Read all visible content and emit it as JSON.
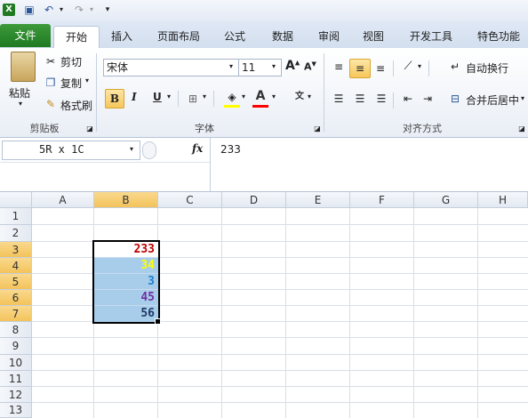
{
  "tabs": [
    "文件",
    "开始",
    "插入",
    "页面布局",
    "公式",
    "数据",
    "审阅",
    "视图",
    "开发工具",
    "特色功能"
  ],
  "clipboard": {
    "paste": "粘贴",
    "cut": "剪切",
    "copy": "复制",
    "format_painter": "格式刷",
    "group": "剪贴板"
  },
  "font": {
    "name": "宋体",
    "size": "11",
    "bold": "B",
    "italic": "I",
    "underline": "U",
    "group": "字体"
  },
  "alignment": {
    "wrap": "自动换行",
    "merge": "合并后居中",
    "group": "对齐方式"
  },
  "formula_bar": {
    "name_box": "5R x 1C",
    "fx": "fx",
    "value": "233"
  },
  "columns": [
    "A",
    "B",
    "C",
    "D",
    "E",
    "F",
    "G",
    "H"
  ],
  "rows": [
    "1",
    "2",
    "3",
    "4",
    "5",
    "6",
    "7",
    "8",
    "9",
    "10",
    "11",
    "12",
    "13"
  ],
  "cells": [
    {
      "ref": "B3",
      "value": "233",
      "color": "#c00000"
    },
    {
      "ref": "B4",
      "value": "34",
      "color": "#ffff00"
    },
    {
      "ref": "B5",
      "value": "3",
      "color": "#1f7fd0"
    },
    {
      "ref": "B6",
      "value": "45",
      "color": "#7030a0"
    },
    {
      "ref": "B7",
      "value": "56",
      "color": "#1f3864"
    }
  ],
  "colors": {
    "file_tab": "#2a862b",
    "selection": "#a8cdea",
    "header_selected": "#f5c866"
  }
}
